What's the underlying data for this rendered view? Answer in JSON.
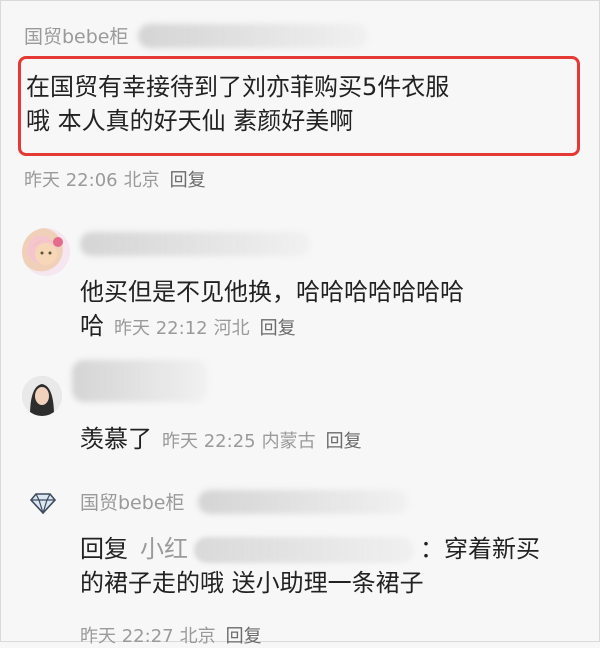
{
  "comments": [
    {
      "author": "国贸bebe柜",
      "text_line1": "在国贸有幸接待到了刘亦菲购买5件衣服",
      "text_line2": "哦 本人真的好天仙 素颜好美啊",
      "time": "昨天 22:06",
      "location": "北京",
      "reply": "回复"
    },
    {
      "text_line1": "他买但是不见他换，哈哈哈哈哈哈哈",
      "text_line2": "哈",
      "time": "昨天 22:12",
      "location": "河北",
      "reply": "回复"
    },
    {
      "text": "羡慕了",
      "time": "昨天 22:25",
      "location": "内蒙古",
      "reply": "回复"
    },
    {
      "author": "国贸bebe柜",
      "reply_prefix": "回复",
      "reply_to": "小红",
      "text_line1": "：穿着新买",
      "text_line2": "的裙子走的哦 送小助理一条裙子",
      "time": "昨天 22:27",
      "location": "北京",
      "reply": "回复"
    }
  ],
  "icons": {
    "diamond": "diamond-icon"
  },
  "colors": {
    "highlight": "#e53935",
    "meta": "#9a9a9a"
  }
}
